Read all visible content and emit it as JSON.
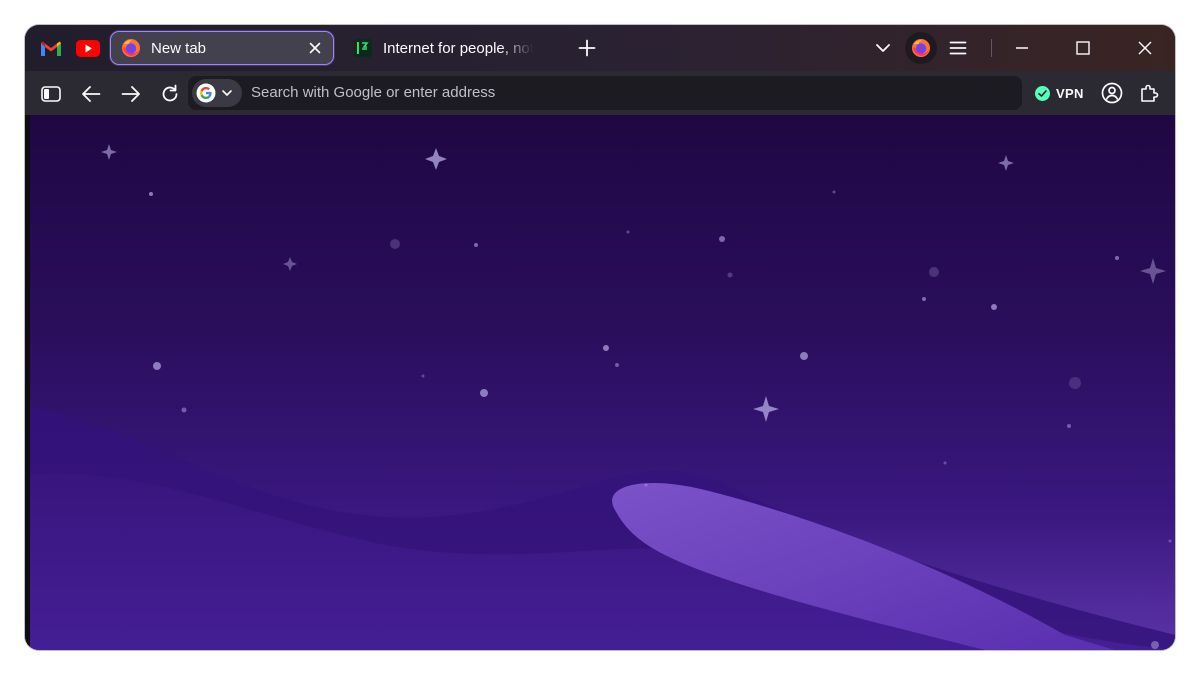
{
  "window": {
    "pinned_tabs": [
      {
        "name": "Gmail",
        "icon": "gmail-icon"
      },
      {
        "name": "YouTube",
        "icon": "youtube-icon"
      }
    ],
    "tabs": [
      {
        "label": "New tab",
        "icon": "firefox-icon",
        "active": true
      },
      {
        "label": "Internet for people, not profit",
        "icon": "mozilla-icon",
        "active": false
      }
    ],
    "controls": {
      "new_tab_icon": "plus-icon",
      "list_tabs_icon": "chevron-down-icon",
      "account_icon": "firefox-icon",
      "menu_icon": "hamburger-icon",
      "minimize_icon": "minimize-icon",
      "maximize_icon": "maximize-icon",
      "close_icon": "close-icon"
    }
  },
  "navbar": {
    "sidebar_icon": "sidebar-icon",
    "back_icon": "back-arrow-icon",
    "forward_icon": "forward-arrow-icon",
    "reload_icon": "reload-icon",
    "search_engine": "google-icon",
    "search_placeholder": "Search with Google or enter address",
    "vpn_label": "VPN",
    "vpn_status_color": "#54ffbd",
    "profile_icon": "profile-icon",
    "extensions_icon": "puzzle-icon"
  },
  "colors": {
    "accent": "#9f83ff",
    "background_top": "#1f0743",
    "background_bottom": "#5b34a8"
  }
}
